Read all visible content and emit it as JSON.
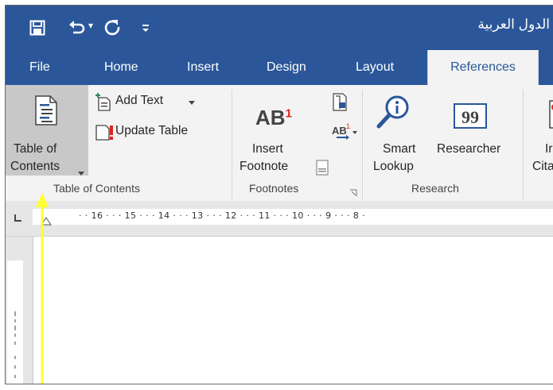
{
  "title_bar": {
    "doc_title": "الدول العربية",
    "qat_icons": [
      "save-icon",
      "undo-icon",
      "redo-icon",
      "customize-qat-icon"
    ],
    "undo_dropdown": "▾"
  },
  "tabs": [
    {
      "label": "File"
    },
    {
      "label": "Home"
    },
    {
      "label": "Insert"
    },
    {
      "label": "Design"
    },
    {
      "label": "Layout"
    },
    {
      "label": "References",
      "active": true
    }
  ],
  "ribbon": {
    "toc_group": {
      "toc_button_line1": "Table of",
      "toc_button_line2": "Contents",
      "add_text": "Add Text",
      "update_table": "Update Table",
      "label": "Table of Contents"
    },
    "footnotes_group": {
      "insert_footnote_line1": "Insert",
      "insert_footnote_line2": "Footnote",
      "ab_glyph": "AB",
      "ab_sup": "1",
      "label": "Footnotes"
    },
    "research_group": {
      "smart_lookup_line1": "Smart",
      "smart_lookup_line2": "Lookup",
      "researcher": "Researcher",
      "label": "Research"
    },
    "citations_partial": {
      "line1": "Ir",
      "line2": "Cita"
    }
  },
  "ruler": {
    "text": "· · 16 · · · 15 · · · 14 · · · 13 · · · 12 · · · 11 · · · 10 · · · 9 · · · 8 ·"
  },
  "annotation": {
    "arrow_color": "#ffff33"
  },
  "colors": {
    "title_bar": "#2b579a",
    "ribbon_bg": "#f3f3f3",
    "active_tab_text": "#2b579a"
  }
}
